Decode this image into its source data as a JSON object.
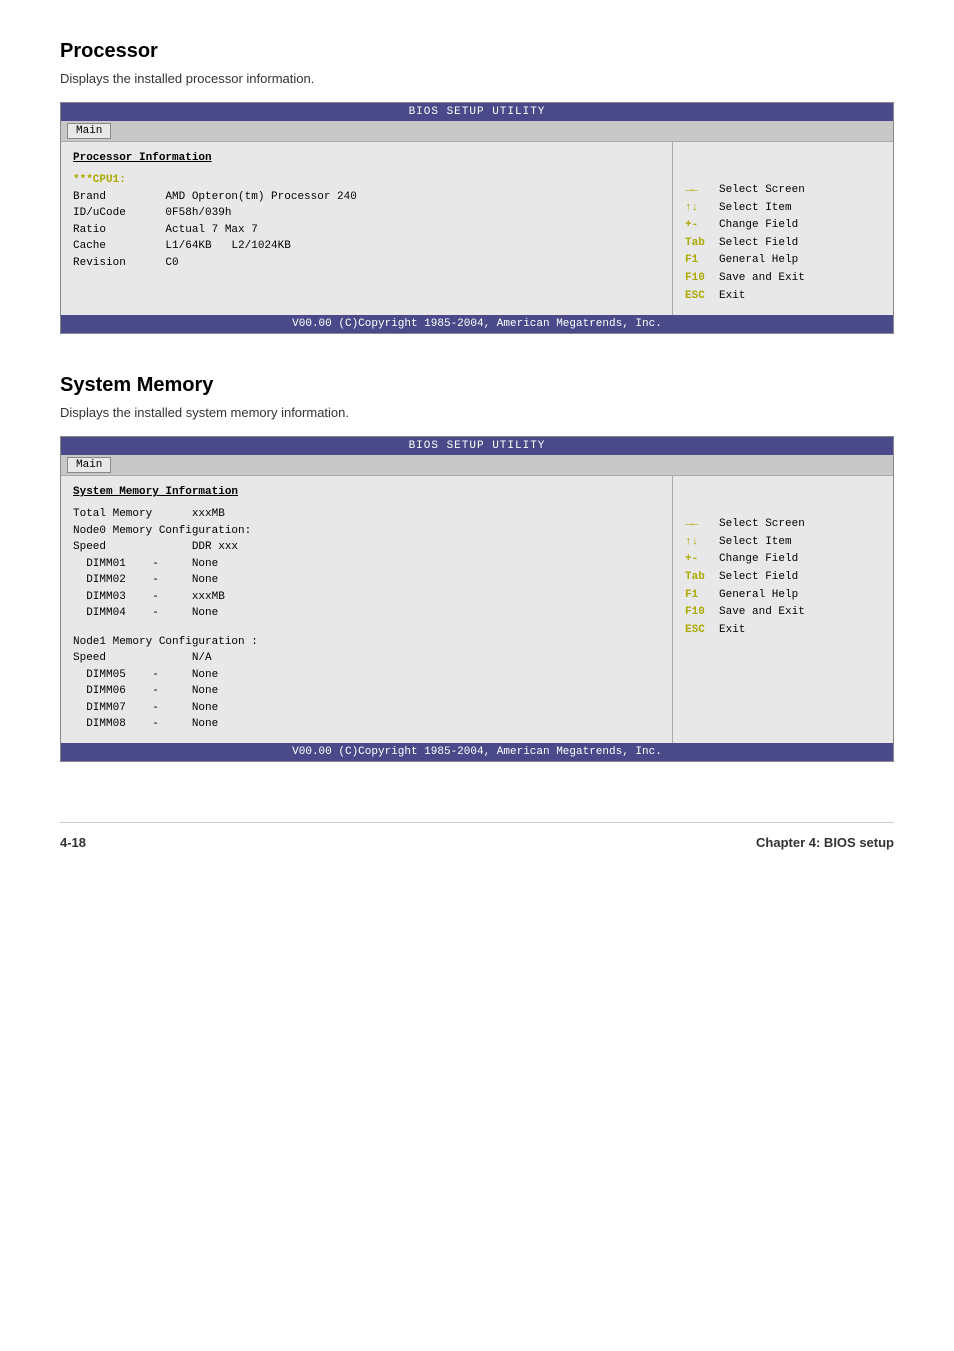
{
  "processor_section": {
    "title": "Processor",
    "description": "Displays the installed processor information.",
    "bios_header": "BIOS SETUP UTILITY",
    "tab_label": "Main",
    "info_title": "Processor Information",
    "cpu_label": "***CPU1:",
    "fields": [
      {
        "label": "Brand",
        "value": "AMD Opteron(tm) Processor 240"
      },
      {
        "label": "ID/uCode",
        "value": "0F58h/039h"
      },
      {
        "label": "Ratio",
        "value": "Actual 7 Max 7"
      },
      {
        "label": "Cache",
        "value": "L1/64KB   L2/1024KB"
      },
      {
        "label": "Revision",
        "value": "C0"
      }
    ],
    "help": [
      {
        "key": "→←",
        "desc": "Select Screen"
      },
      {
        "key": "↑↓",
        "desc": "Select Item"
      },
      {
        "key": "+-",
        "desc": "Change Field"
      },
      {
        "key": "Tab",
        "desc": "Select Field"
      },
      {
        "key": "F1",
        "desc": "General Help"
      },
      {
        "key": "F10",
        "desc": "Save and Exit"
      },
      {
        "key": "ESC",
        "desc": "Exit"
      }
    ],
    "footer": "V00.00 (C)Copyright 1985-2004, American Megatrends, Inc."
  },
  "memory_section": {
    "title": "System Memory",
    "description": "Displays the installed system memory information.",
    "bios_header": "BIOS SETUP UTILITY",
    "tab_label": "Main",
    "info_title": "System Memory Information",
    "total_memory_label": "Total Memory",
    "total_memory_value": "xxxMB",
    "node0_label": "Node0 Memory Configuration:",
    "node0_speed_label": "Speed",
    "node0_speed_value": "DDR xxx",
    "node0_dimms": [
      {
        "name": "DIMM01",
        "sep": "-",
        "value": "None"
      },
      {
        "name": "DIMM02",
        "sep": "-",
        "value": "None"
      },
      {
        "name": "DIMM03",
        "sep": "-",
        "value": "xxxMB"
      },
      {
        "name": "DIMM04",
        "sep": "-",
        "value": "None"
      }
    ],
    "node1_label": "Node1 Memory Configuration :",
    "node1_speed_label": "Speed",
    "node1_speed_value": "N/A",
    "node1_dimms": [
      {
        "name": "DIMM05",
        "sep": "-",
        "value": "None"
      },
      {
        "name": "DIMM06",
        "sep": "-",
        "value": "None"
      },
      {
        "name": "DIMM07",
        "sep": "-",
        "value": "None"
      },
      {
        "name": "DIMM08",
        "sep": "-",
        "value": "None"
      }
    ],
    "help": [
      {
        "key": "→←",
        "desc": "Select Screen"
      },
      {
        "key": "↑↓",
        "desc": "Select Item"
      },
      {
        "key": "+-",
        "desc": "Change Field"
      },
      {
        "key": "Tab",
        "desc": "Select Field"
      },
      {
        "key": "F1",
        "desc": "General Help"
      },
      {
        "key": "F10",
        "desc": "Save and Exit"
      },
      {
        "key": "ESC",
        "desc": "Exit"
      }
    ],
    "footer": "V00.00 (C)Copyright 1985-2004, American Megatrends, Inc."
  },
  "page_footer": {
    "left": "4-18",
    "right": "Chapter 4: BIOS setup"
  }
}
